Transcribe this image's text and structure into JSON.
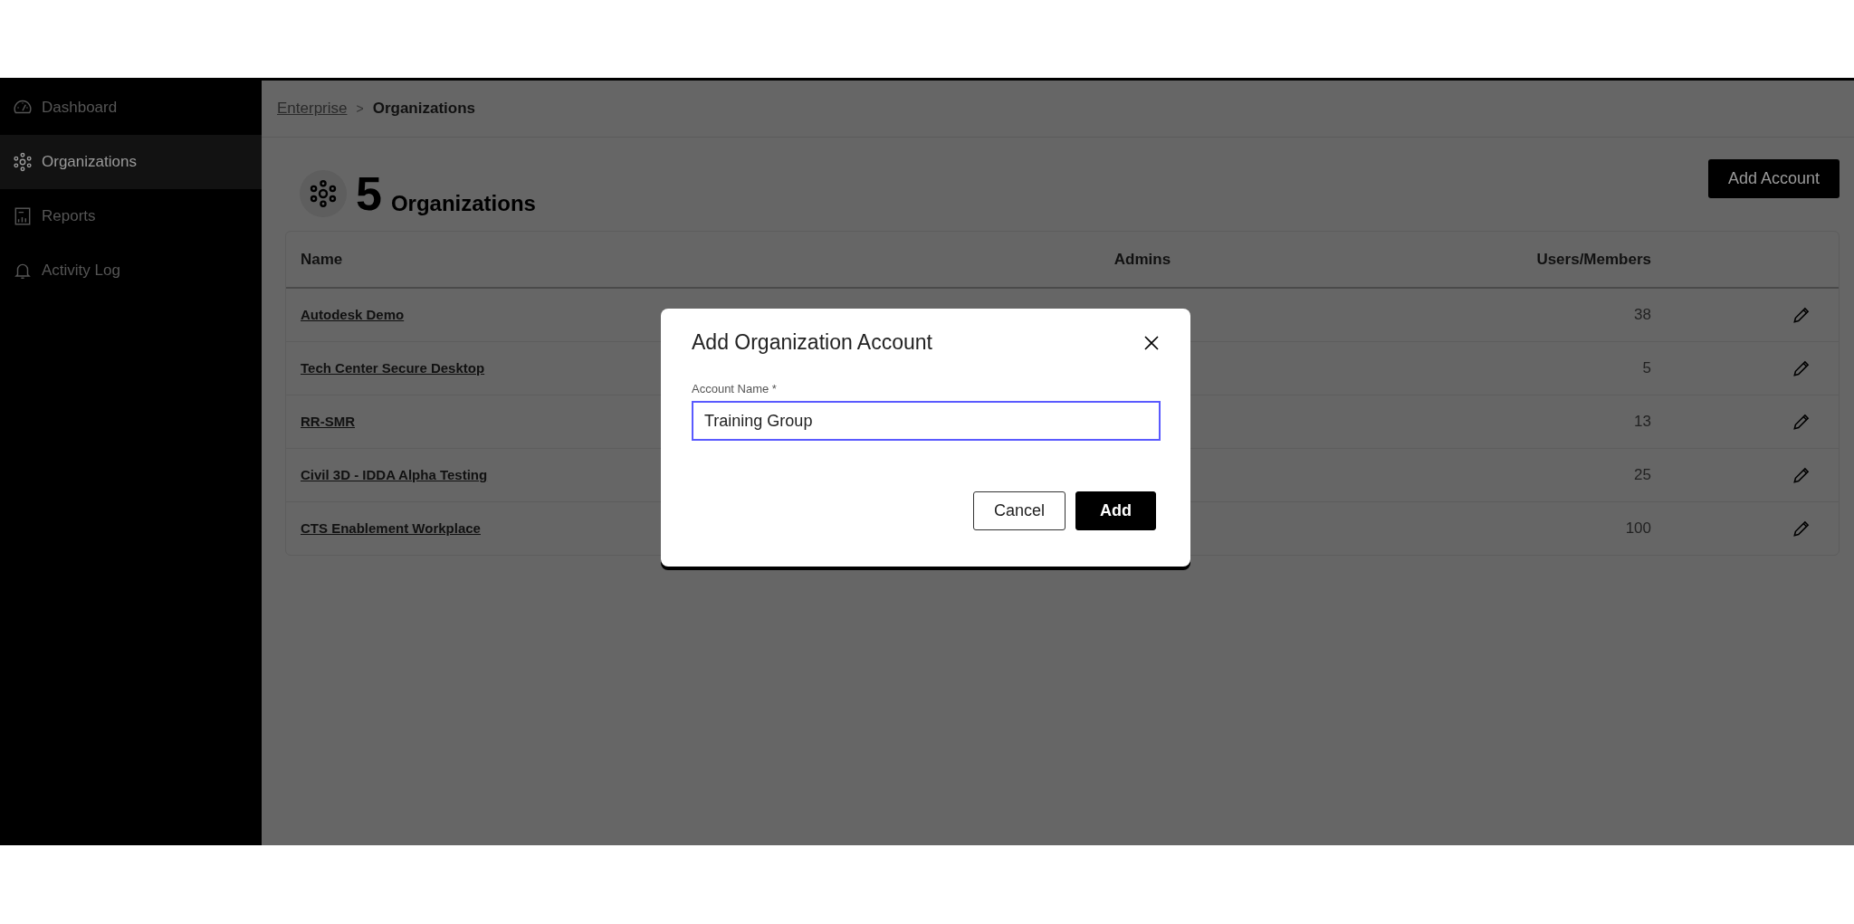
{
  "sidebar": {
    "items": [
      {
        "label": "Dashboard",
        "selected": false
      },
      {
        "label": "Organizations",
        "selected": true
      },
      {
        "label": "Reports",
        "selected": false
      },
      {
        "label": "Activity Log",
        "selected": false
      }
    ]
  },
  "breadcrumb": {
    "items": [
      {
        "label": "Enterprise",
        "kind": "link"
      },
      {
        "label": "Organizations",
        "kind": "current"
      }
    ],
    "separator": ">"
  },
  "header": {
    "count": "5",
    "title": "Organizations",
    "button": "Add Account"
  },
  "table": {
    "columns": [
      "Name",
      "Admins",
      "Users/Members"
    ],
    "rows": [
      {
        "name": "Autodesk Demo",
        "users": "38"
      },
      {
        "name": "Tech Center Secure Desktop",
        "users": "5"
      },
      {
        "name": "RR-SMR",
        "users": "13"
      },
      {
        "name": "Civil 3D - IDDA Alpha Testing",
        "users": "25"
      },
      {
        "name": "CTS Enablement Workplace",
        "users": "100"
      }
    ]
  },
  "dialog": {
    "title": "Add Organization Account",
    "field": {
      "label": "Account Name *",
      "value": "Training Group",
      "focused": true
    },
    "buttons": [
      {
        "label": "Cancel",
        "kind": "secondary"
      },
      {
        "label": "Add",
        "kind": "primary"
      }
    ]
  }
}
